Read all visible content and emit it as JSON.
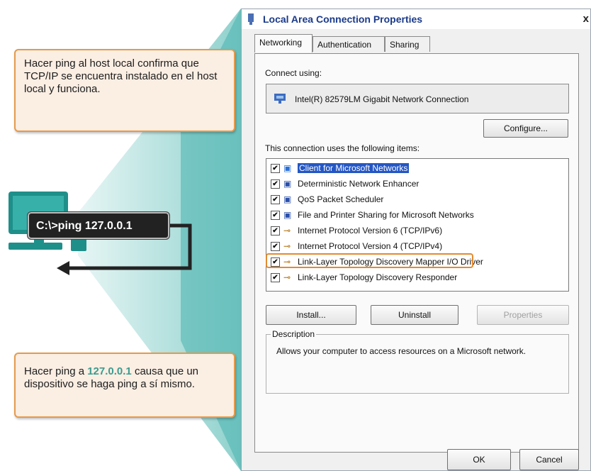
{
  "callouts": {
    "top": "Hacer ping al host local confirma que TCP/IP se encuentra instalado en el host local y funciona.",
    "bottom_prefix": "Hacer ping a ",
    "bottom_highlight": "127.0.0.1",
    "bottom_suffix": " causa que un dispositivo se haga ping a sí mismo."
  },
  "command": "C:\\>ping 127.0.0.1",
  "dialog": {
    "title": "Local Area Connection Properties",
    "close": "x",
    "tabs": [
      "Networking",
      "Authentication",
      "Sharing"
    ],
    "connect_using_label": "Connect using:",
    "adapter_name": "Intel(R) 82579LM Gigabit Network Connection",
    "configure_label": "Configure...",
    "items_label": "This connection uses the following items:",
    "items": [
      {
        "label": "Client for Microsoft Networks",
        "checked": true,
        "icon": "network-client-icon"
      },
      {
        "label": "Deterministic Network Enhancer",
        "checked": true,
        "icon": "network-service-icon"
      },
      {
        "label": "QoS Packet Scheduler",
        "checked": true,
        "icon": "network-service-icon"
      },
      {
        "label": "File and Printer Sharing for Microsoft Networks",
        "checked": true,
        "icon": "network-service-icon"
      },
      {
        "label": "Internet Protocol Version 6 (TCP/IPv6)",
        "checked": true,
        "icon": "protocol-icon"
      },
      {
        "label": "Internet Protocol Version 4 (TCP/IPv4)",
        "checked": true,
        "icon": "protocol-icon"
      },
      {
        "label": "Link-Layer Topology Discovery Mapper I/O Driver",
        "checked": true,
        "icon": "protocol-icon"
      },
      {
        "label": "Link-Layer Topology Discovery Responder",
        "checked": true,
        "icon": "protocol-icon"
      }
    ],
    "install_label": "Install...",
    "uninstall_label": "Uninstall",
    "properties_label": "Properties",
    "description_legend": "Description",
    "description_text": "Allows your computer to access resources on a Microsoft network.",
    "ok_label": "OK",
    "cancel_label": "Cancel"
  },
  "colors": {
    "callout_border": "#e59a4c",
    "highlight": "#3c9b8f",
    "beam": "#4fb8b3",
    "selection": "#2456c4"
  }
}
